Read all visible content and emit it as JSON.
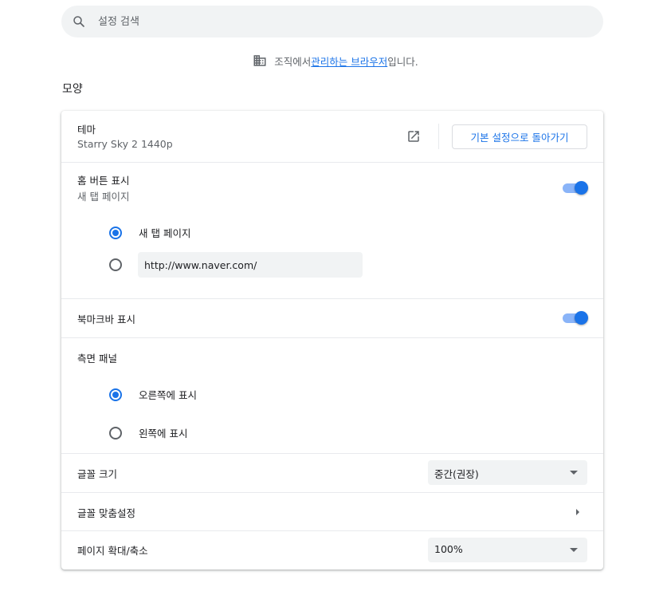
{
  "search": {
    "placeholder": "설정 검색",
    "icon": "search-icon"
  },
  "managed": {
    "prefix": "조직에서 ",
    "link": "관리하는 브라우저",
    "suffix": "입니다.",
    "icon": "building-icon"
  },
  "section_title": "모양",
  "theme": {
    "label": "테마",
    "value": "Starry Sky 2 1440p",
    "open_icon": "open-in-new-icon",
    "reset_label": "기본 설정으로 돌아가기"
  },
  "home_button": {
    "label": "홈 버튼 표시",
    "sublabel": "새 탭 페이지",
    "enabled": true,
    "options": [
      {
        "label": "새 탭 페이지",
        "selected": true
      },
      {
        "label": "",
        "selected": false
      }
    ],
    "url_value": "http://www.naver.com/"
  },
  "bookmarks_bar": {
    "label": "북마크바 표시",
    "enabled": true
  },
  "side_panel": {
    "label": "측면 패널",
    "options": [
      {
        "label": "오른쪽에 표시",
        "selected": true
      },
      {
        "label": "왼쪽에 표시",
        "selected": false
      }
    ]
  },
  "font_size": {
    "label": "글꼴 크기",
    "value": "중간(권장)"
  },
  "customize_fonts": {
    "label": "글꼴 맞춤설정"
  },
  "page_zoom": {
    "label": "페이지 확대/축소",
    "value": "100%"
  },
  "colors": {
    "accent": "#1a73e8",
    "toggle_track": "#8ab4f8",
    "field_bg": "#f1f3f4"
  }
}
